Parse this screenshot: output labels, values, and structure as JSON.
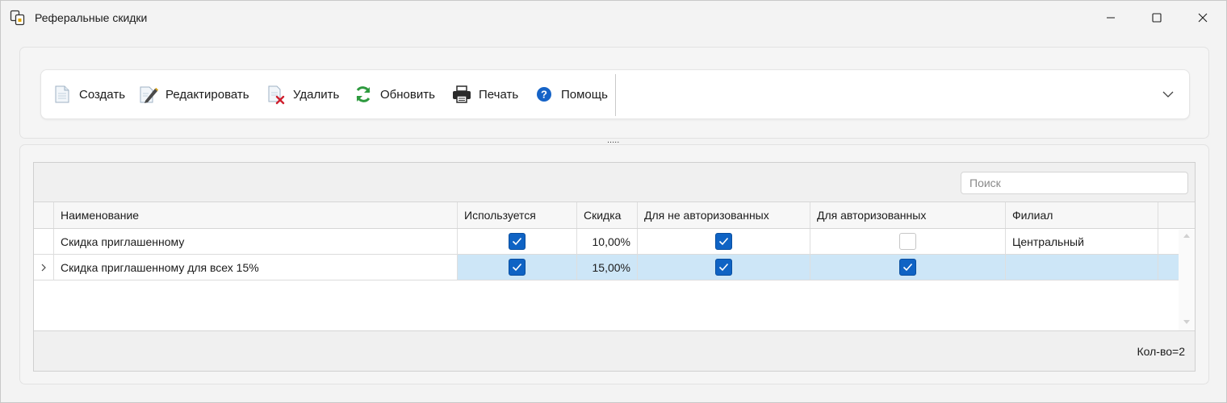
{
  "window": {
    "title": "Реферальные скидки",
    "app_icon": "app-document-icon",
    "controls": [
      "minimize-icon",
      "maximize-icon",
      "close-icon"
    ]
  },
  "toolbar": {
    "buttons": [
      {
        "label": "Создать",
        "icon": "new-document-icon"
      },
      {
        "label": "Редактировать",
        "icon": "edit-pencil-icon"
      },
      {
        "label": "Удалить",
        "icon": "delete-document-icon"
      },
      {
        "label": "Обновить",
        "icon": "refresh-icon"
      },
      {
        "label": "Печать",
        "icon": "printer-icon"
      },
      {
        "label": "Помощь",
        "icon": "help-icon"
      }
    ],
    "expand_icon": "chevron-down-icon",
    "splitter": "....."
  },
  "grid": {
    "search": {
      "placeholder": "Поиск",
      "value": ""
    },
    "columns": [
      "Наименование",
      "Используется",
      "Скидка",
      "Для не авторизованных",
      "Для авторизованных",
      "Филиал"
    ],
    "rows": [
      {
        "name": "Скидка приглашенному",
        "used": true,
        "discount": "10,00%",
        "unauth": true,
        "auth": false,
        "branch": "Центральный",
        "selected": false
      },
      {
        "name": "Скидка приглашенному для всех 15%",
        "used": true,
        "discount": "15,00%",
        "unauth": true,
        "auth": true,
        "branch": "",
        "selected": true
      }
    ],
    "footer": {
      "count": "Кол-во=2"
    },
    "colors": {
      "checkbox": "#0f63c4",
      "selection": "#cde6f7"
    }
  }
}
